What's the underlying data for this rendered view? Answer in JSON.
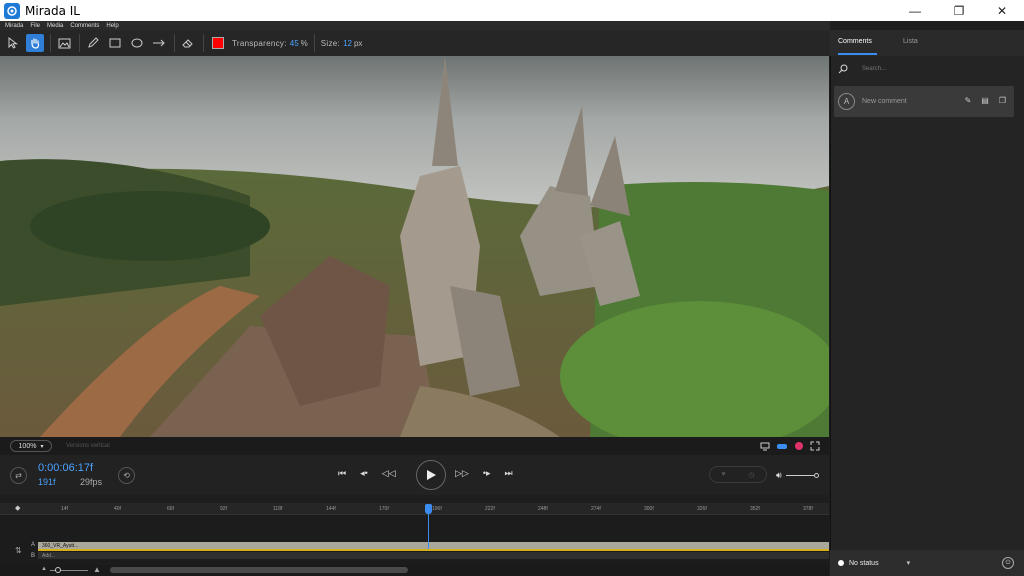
{
  "app": {
    "title": "Mirada IL"
  },
  "menu": {
    "items": [
      "Mirada",
      "File",
      "Media",
      "Comments",
      "Help"
    ]
  },
  "toolbar": {
    "transparency_label": "Transparency:",
    "transparency_value": "45",
    "transparency_unit": "%",
    "size_label": "Size:",
    "size_value": "12",
    "size_unit": "px",
    "color": "#ff0000"
  },
  "viewer": {
    "zoom": "100%",
    "version": "Versions vertical"
  },
  "transport": {
    "timecode": "0:00:06:17f",
    "frame": "191f",
    "fps": "29fps"
  },
  "ruler": {
    "labels": [
      "14f",
      "40f",
      "66f",
      "92f",
      "118f",
      "144f",
      "170f",
      "196f",
      "222f",
      "248f",
      "274f",
      "300f",
      "326f",
      "352f",
      "378f"
    ]
  },
  "tracks": {
    "a_label": "A",
    "b_label": "B",
    "a_name": "360_VR_Ayutt...",
    "b_name": "Add..."
  },
  "panel": {
    "tab_comments": "Comments",
    "tab_list": "Lista",
    "search_placeholder": "Search...",
    "comment_avatar": "A",
    "comment_placeholder": "New comment",
    "status": "No status"
  },
  "colors": {
    "accent": "#3b8ef0",
    "track_gold": "#d6b01a"
  }
}
